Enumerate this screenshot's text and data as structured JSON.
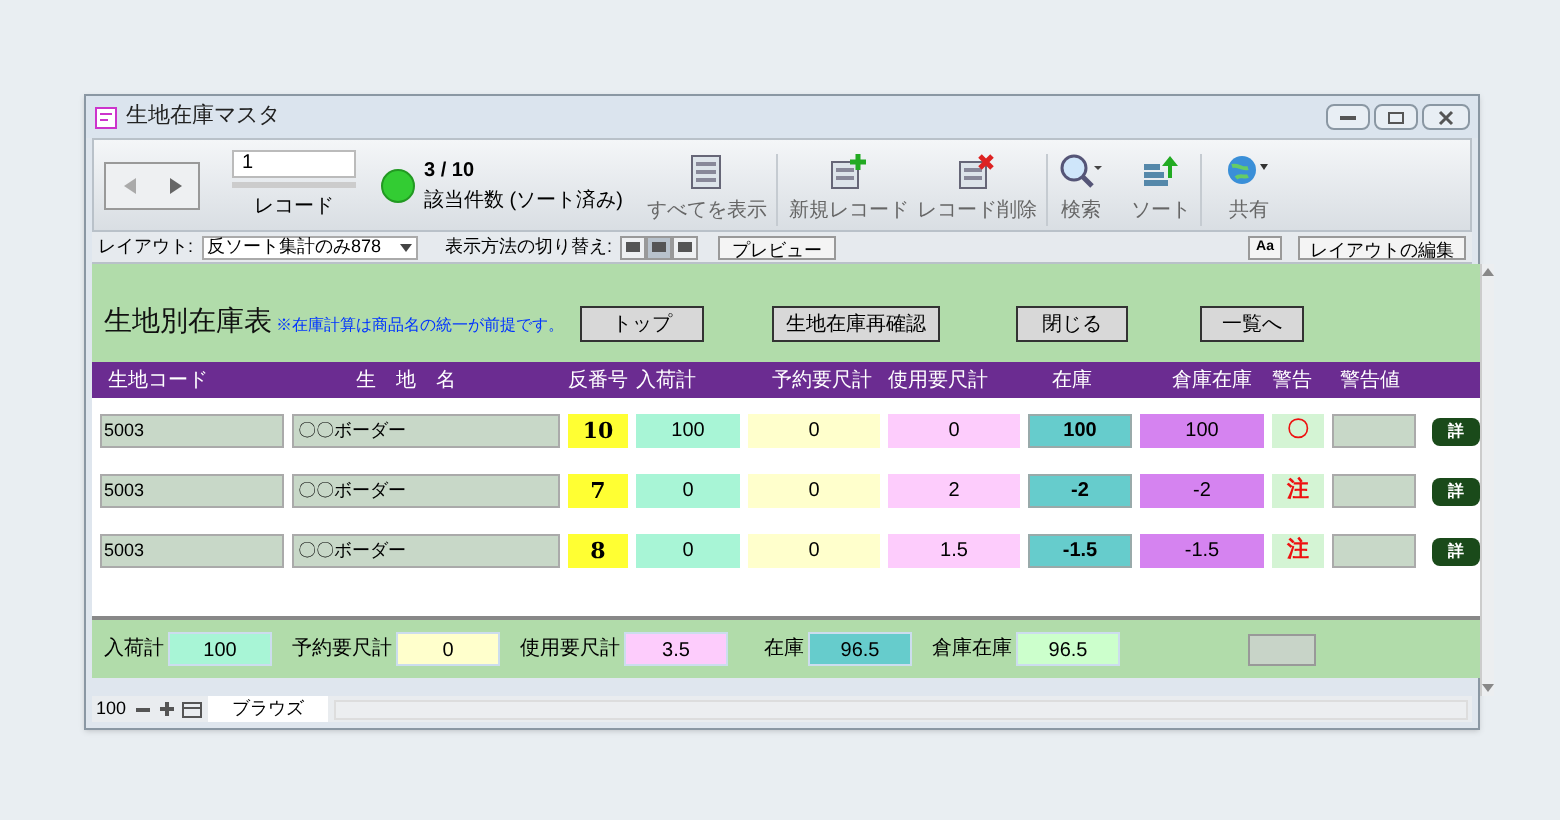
{
  "window": {
    "title": "生地在庫マスタ"
  },
  "toolbar": {
    "record_value": "1",
    "record_label": "レコード",
    "count": "3 / 10",
    "count_label": "該当件数 (ソート済み)",
    "buttons": [
      {
        "label": "すべてを表示",
        "kind": "all"
      },
      {
        "label": "新規レコード",
        "kind": "new"
      },
      {
        "label": "レコード削除",
        "kind": "delete"
      },
      {
        "label": "検索",
        "kind": "search"
      },
      {
        "label": "ソート",
        "kind": "sort"
      },
      {
        "label": "共有",
        "kind": "share"
      }
    ]
  },
  "layout_bar": {
    "layout_label": "レイアウト:",
    "layout_value": "反ソート集計のみ878",
    "view_label": "表示方法の切り替え:",
    "view_modes": [
      {
        "selected": false
      },
      {
        "selected": true
      },
      {
        "selected": false
      }
    ],
    "preview": "プレビュー",
    "font_button": "Aa",
    "edit_layout": "レイアウトの編集"
  },
  "header": {
    "title": "生地別在庫表",
    "note": "※在庫計算は商品名の統一が前提です。",
    "buttons": [
      "トップ",
      "生地在庫再確認",
      "閉じる",
      "一覧へ"
    ]
  },
  "table": {
    "columns": [
      "生地コード",
      "生　地　名",
      "反番号",
      "入荷計",
      "予約要尺計",
      "使用要尺計",
      "在庫",
      "倉庫在庫",
      "警告",
      "警告値"
    ],
    "rows": [
      {
        "code": "5003",
        "name": "〇〇ボーダー",
        "number": "10",
        "received": "100",
        "reserved": "0",
        "used": "0",
        "stock": "100",
        "warehouse": "100",
        "warning": "〇",
        "detail": "詳"
      },
      {
        "code": "5003",
        "name": "〇〇ボーダー",
        "number": "7",
        "received": "0",
        "reserved": "0",
        "used": "2",
        "stock": "-2",
        "warehouse": "-2",
        "warning": "注",
        "detail": "詳"
      },
      {
        "code": "5003",
        "name": "〇〇ボーダー",
        "number": "8",
        "received": "0",
        "reserved": "0",
        "used": "1.5",
        "stock": "-1.5",
        "warehouse": "-1.5",
        "warning": "注",
        "detail": "詳"
      }
    ]
  },
  "footer": [
    {
      "label": "入荷計",
      "value": "100",
      "kind": "received"
    },
    {
      "label": "予約要尺計",
      "value": "0",
      "kind": "reserved"
    },
    {
      "label": "使用要尺計",
      "value": "3.5",
      "kind": "used"
    },
    {
      "label": "在庫",
      "value": "96.5",
      "kind": "stock"
    },
    {
      "label": "倉庫在庫",
      "value": "96.5",
      "kind": "warehouse"
    }
  ],
  "status_bar": {
    "zoom": "100",
    "mode": "ブラウズ"
  }
}
